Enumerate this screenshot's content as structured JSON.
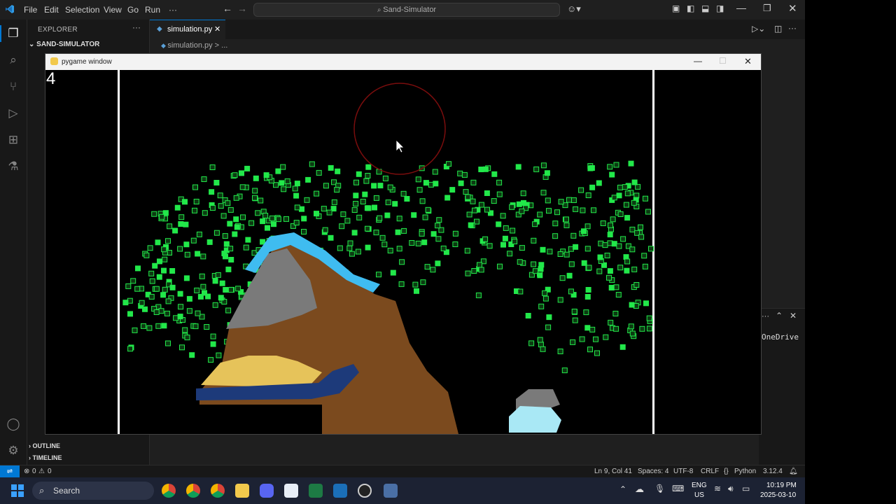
{
  "titlebar": {
    "menu": [
      "File",
      "Edit",
      "Selection",
      "View",
      "Go",
      "Run",
      "···"
    ],
    "command_center": "Sand-Simulator"
  },
  "sidebar": {
    "header": "EXPLORER",
    "project": "SAND-SIMULATOR",
    "outline": "OUTLINE",
    "timeline": "TIMELINE"
  },
  "editor": {
    "tab_label": "simulation.py",
    "breadcrumb": "simulation.py  >  ..."
  },
  "panel": {
    "onedrive_text": "OneDrive"
  },
  "pygame": {
    "title": "pygame window",
    "counter": "4"
  },
  "statusbar": {
    "errors": "0",
    "warnings": "0",
    "position": "Ln 9, Col 41",
    "spaces": "Spaces: 4",
    "encoding": "UTF-8",
    "eol": "CRLF",
    "language": "Python",
    "version": "3.12.4"
  },
  "taskbar": {
    "search": "Search",
    "lang_top": "ENG",
    "lang_bottom": "US",
    "time": "10:19 PM",
    "date": "2025-03-10"
  },
  "colors": {
    "vscode_blue": "#0078d4",
    "particle_green": "#22e84a",
    "water_cyan": "#3fbcf0",
    "dirt_brown": "#7b4a1e",
    "stone_gray": "#7a7a7a",
    "sand_yellow": "#e6c35a",
    "brick_navy": "#1d3a7a",
    "cursor_ring": "#7a0d0d"
  }
}
